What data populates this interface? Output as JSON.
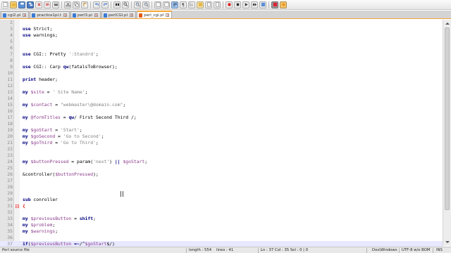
{
  "tabs": [
    {
      "label": "cgi2.pl",
      "active": false
    },
    {
      "label": "practice1pl.t",
      "active": false
    },
    {
      "label": "perl3.pl",
      "active": false
    },
    {
      "label": "perlCGI.pl",
      "active": false
    },
    {
      "label": "perl_cgi.pl",
      "active": true
    }
  ],
  "code_lines": [
    {
      "num": "2",
      "text": ""
    },
    {
      "num": "3",
      "text": "use Strict;"
    },
    {
      "num": "4",
      "text": "use warnings;"
    },
    {
      "num": "5",
      "text": ""
    },
    {
      "num": "6",
      "text": ""
    },
    {
      "num": "7",
      "text": "use CGI:: Pretty ':Standrd';"
    },
    {
      "num": "8",
      "text": ""
    },
    {
      "num": "9",
      "text": "use CGI:: Carp qw(fatalsToBrowser);"
    },
    {
      "num": "10",
      "text": ""
    },
    {
      "num": "11",
      "text": "print header;"
    },
    {
      "num": "12",
      "text": ""
    },
    {
      "num": "13",
      "text": "my $site = ' Site Name';"
    },
    {
      "num": "14",
      "text": ""
    },
    {
      "num": "15",
      "text": "my $contact = \"webmaster\\@domain.com\";"
    },
    {
      "num": "16",
      "text": ""
    },
    {
      "num": "17",
      "text": "my @formTitles = qw/ First Second Third /;"
    },
    {
      "num": "18",
      "text": ""
    },
    {
      "num": "19",
      "text": "my $goStart = 'Start';"
    },
    {
      "num": "20",
      "text": "my $goSecond = 'Go to Second';"
    },
    {
      "num": "21",
      "text": "my $goThird = 'Go to Third';"
    },
    {
      "num": "22",
      "text": ""
    },
    {
      "num": "23",
      "text": ""
    },
    {
      "num": "24",
      "text": "my $buttonPressed = param('next') || $goStart;"
    },
    {
      "num": "25",
      "text": ""
    },
    {
      "num": "26",
      "text": "&controller($buttonPressed);"
    },
    {
      "num": "27",
      "text": ""
    },
    {
      "num": "28",
      "text": ""
    },
    {
      "num": "29",
      "text": ""
    },
    {
      "num": "30",
      "text": "sub conroller"
    },
    {
      "num": "31",
      "text": "{"
    },
    {
      "num": "32",
      "text": ""
    },
    {
      "num": "33",
      "text": "my $previousButton = shift;"
    },
    {
      "num": "34",
      "text": "my $problem;"
    },
    {
      "num": "35",
      "text": "my $warnings;"
    },
    {
      "num": "36",
      "text": ""
    },
    {
      "num": "37",
      "text": "if($previousButton =~/^$goStart$/)"
    }
  ],
  "status": {
    "file_type": "Perl source file",
    "length": "length : 554",
    "lines": "lines : 41",
    "position": "Ln : 37    Col : 35    Sel : 0 | 0",
    "eol": "Dos\\Windows",
    "encoding": "UTF-8 w/o BOM",
    "mode": "INS"
  },
  "colors": {
    "active_tab_accent": "#f7a630",
    "keyword": "#000080",
    "variable": "#8a3b8a",
    "string": "#808080",
    "brace_highlight": "#e00000",
    "current_line": "#e8e8ff"
  }
}
